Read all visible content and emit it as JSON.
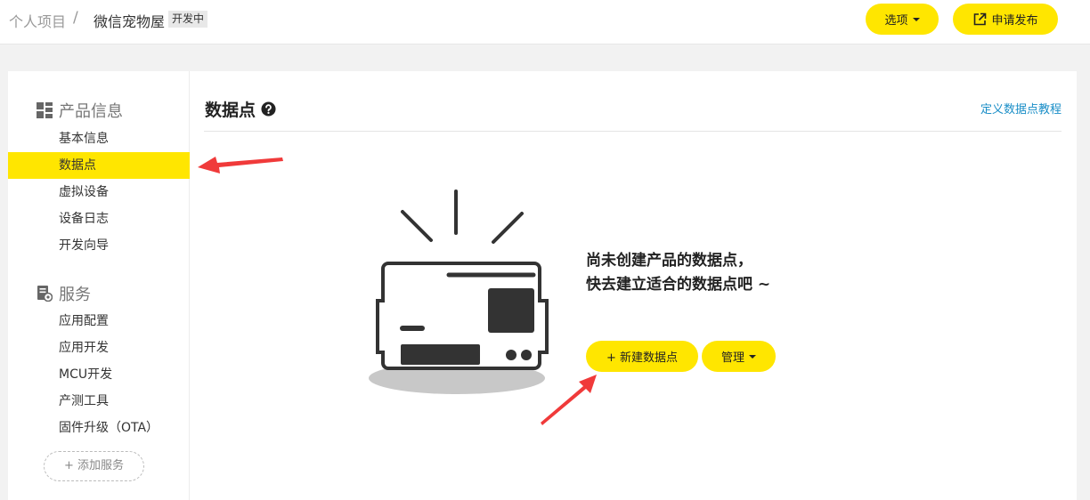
{
  "breadcrumb": {
    "root": "个人项目",
    "separator": "/",
    "current": "微信宠物屋",
    "status_badge": "开发中"
  },
  "header": {
    "options_label": "选项",
    "publish_label": "申请发布"
  },
  "sidebar": {
    "product_section": {
      "title": "产品信息",
      "items": [
        {
          "label": "基本信息"
        },
        {
          "label": "数据点"
        },
        {
          "label": "虚拟设备"
        },
        {
          "label": "设备日志"
        },
        {
          "label": "开发向导"
        }
      ]
    },
    "service_section": {
      "title": "服务",
      "items": [
        {
          "label": "应用配置"
        },
        {
          "label": "应用开发"
        },
        {
          "label": "MCU开发"
        },
        {
          "label": "产测工具"
        },
        {
          "label": "固件升级（OTA）"
        }
      ]
    },
    "add_service_label": "+ 添加服务",
    "active_item": "数据点"
  },
  "main": {
    "title": "数据点",
    "tutorial_link": "定义数据点教程",
    "empty_line1": "尚未创建产品的数据点，",
    "empty_line2": "快去建立适合的数据点吧 ~",
    "new_button_label": "+ 新建数据点",
    "manage_button_label": "管理"
  },
  "colors": {
    "accent": "#ffe600",
    "link": "#1a8ec7",
    "annotation_arrow": "#f03a3a",
    "illustration_dark": "#333333",
    "illustration_shadow": "#c8c8c8"
  },
  "icons": {
    "product_section": "grid-icon",
    "service_section": "service-doc-icon",
    "help": "question-circle-icon",
    "publish": "external-link-icon",
    "illustration": "device-board-illustration"
  }
}
